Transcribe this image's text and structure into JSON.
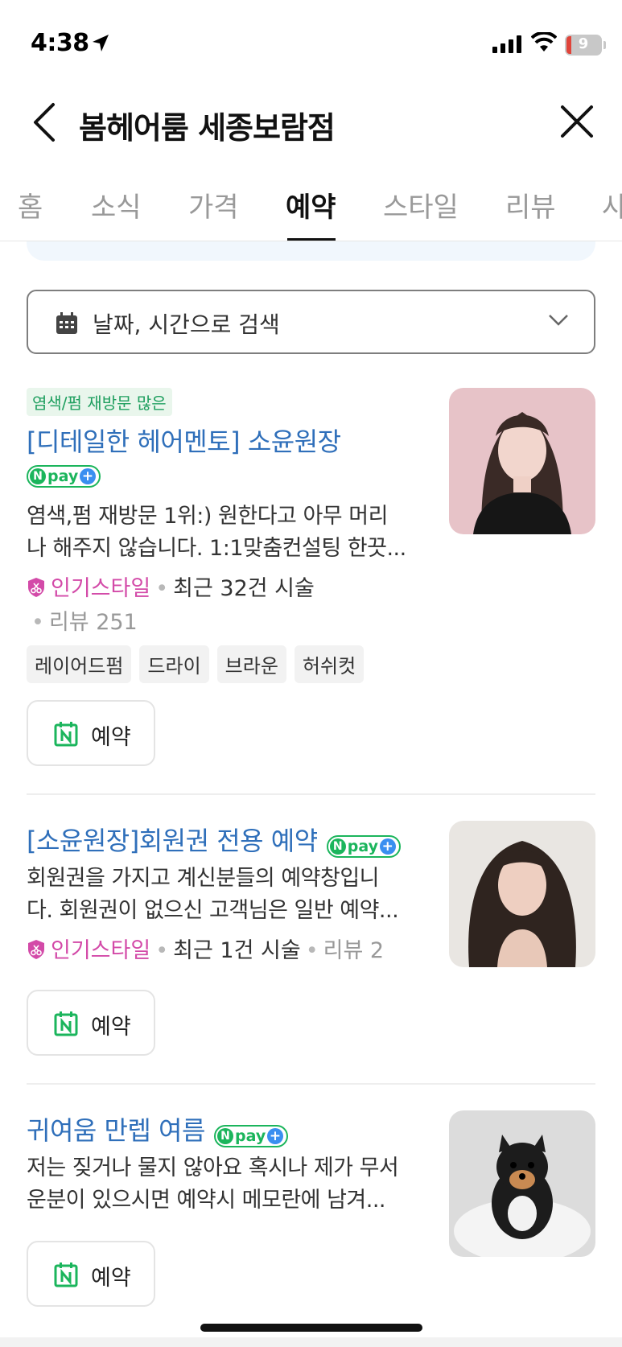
{
  "status_bar": {
    "time": "4:38",
    "battery": "9"
  },
  "header": {
    "title": "봄헤어룸 세종보람점"
  },
  "tabs": [
    {
      "label": "홈",
      "active": false
    },
    {
      "label": "소식",
      "active": false
    },
    {
      "label": "가격",
      "active": false
    },
    {
      "label": "예약",
      "active": true
    },
    {
      "label": "스타일",
      "active": false
    },
    {
      "label": "리뷰",
      "active": false
    },
    {
      "label": "사",
      "active": false
    }
  ],
  "date_search": {
    "label": "날짜, 시간으로 검색"
  },
  "npay": {
    "n": "N",
    "pay": "pay",
    "plus": "+"
  },
  "items": [
    {
      "badge": "염색/펌 재방문 많은",
      "title": "[디테일한 헤어멘토] 소윤원장",
      "desc_line1": "염색,펌 재방문 1위:) 원한다고 아무 머리",
      "desc_line2": "나 해주지 않습니다. 1:1맞춤컨설팅 한끗...",
      "popular": "인기스타일",
      "recent": "최근 32건 시술",
      "review": "리뷰 251",
      "chips": [
        "레이어드펌",
        "드라이",
        "브라운",
        "허쉬컷"
      ],
      "button": "예약"
    },
    {
      "title": "[소윤원장]회원권 전용 예약",
      "desc_line1": "회원권을 가지고 계신분들의 예약창입니",
      "desc_line2": "다. 회원권이 없으신 고객님은 일반 예약...",
      "popular": "인기스타일",
      "recent": "최근 1건 시술",
      "review": "리뷰 2",
      "button": "예약"
    },
    {
      "title": "귀여움 만렙 여름",
      "desc_line1": "저는 짖거나 물지 않아요 혹시나 제가 무서",
      "desc_line2": "운분이 있으시면 예약시 메모란에 남겨...",
      "button": "예약"
    }
  ],
  "colors": {
    "link_blue": "#2f6fba",
    "popular_pink": "#d34aa8",
    "npay_green": "#1bb55c",
    "badge_green": "#1f9f5f"
  }
}
